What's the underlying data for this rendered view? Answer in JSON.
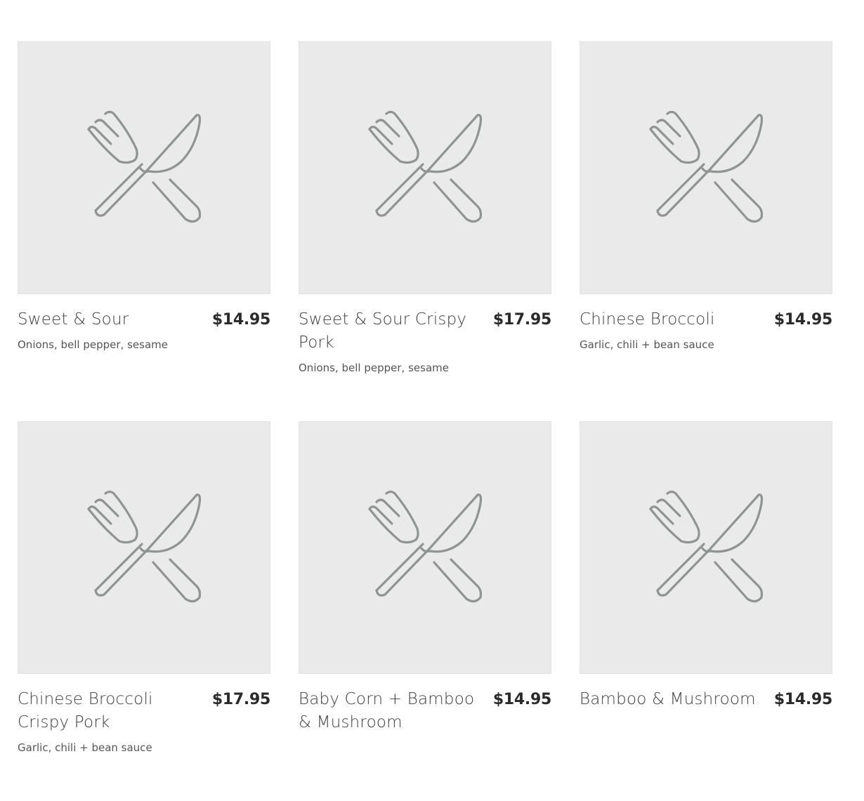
{
  "menu": {
    "items": [
      {
        "name": "Sweet & Sour",
        "price": "$14.95",
        "description": "Onions, bell pepper, sesame",
        "image_icon": "fork-knife-icon"
      },
      {
        "name": "Sweet & Sour Crispy Pork",
        "price": "$17.95",
        "description": "Onions, bell pepper, sesame",
        "image_icon": "fork-knife-icon"
      },
      {
        "name": "Chinese Broccoli",
        "price": "$14.95",
        "description": "Garlic, chili + bean sauce",
        "image_icon": "fork-knife-icon"
      },
      {
        "name": "Chinese Broccoli Crispy Pork",
        "price": "$17.95",
        "description": "Garlic, chili + bean sauce",
        "image_icon": "fork-knife-icon"
      },
      {
        "name": "Baby Corn + Bamboo & Mushroom",
        "price": "$14.95",
        "description": "",
        "image_icon": "fork-knife-icon"
      },
      {
        "name": "Bamboo & Mushroom",
        "price": "$14.95",
        "description": "",
        "image_icon": "fork-knife-icon"
      }
    ]
  },
  "colors": {
    "placeholder_bg": "#eaeaea",
    "icon_stroke": "#8e9393"
  }
}
